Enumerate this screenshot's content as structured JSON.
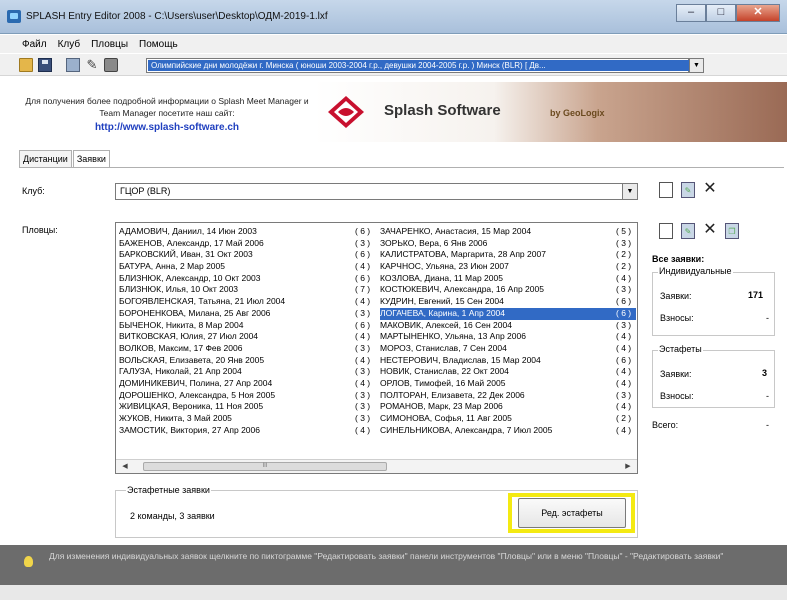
{
  "window": {
    "title": "SPLASH Entry Editor 2008 - C:\\Users\\user\\Desktop\\ОДМ-2019-1.lxf",
    "min_label": "–",
    "max_label": "□",
    "close_label": "✕"
  },
  "menu": [
    "Файл",
    "Клуб",
    "Пловцы",
    "Помощь"
  ],
  "meet": {
    "selected": "Олимпийские дни молодёжи г. Минска ( юноши 2003-2004 г.р., девушки 2004-2005 г.р. ) Минск (BLR) [ Дв..."
  },
  "info": {
    "text": "Для получения более подробной информации о Splash Meet Manager и Team Manager посетите наш сайт:",
    "link": "http://www.splash-software.ch"
  },
  "banner": {
    "brand": "Splash Software",
    "by": "by GeoLogix"
  },
  "tabs": [
    "Дистанции",
    "Заявки"
  ],
  "club": {
    "label": "Клуб:",
    "value": "ГЦОР (BLR)"
  },
  "swimmers_label": "Пловцы:",
  "swimmers_col1": [
    {
      "name": "АДАМОВИЧ, Даниил, 14 Июн 2003",
      "count": "( 6 )"
    },
    {
      "name": "БАЖЕНОВ, Александр, 17 Май 2006",
      "count": "( 3 )"
    },
    {
      "name": "БАРКОВСКИЙ, Иван, 31 Окт 2003",
      "count": "( 6 )"
    },
    {
      "name": "БАТУРА, Анна, 2 Мар 2005",
      "count": "( 4 )"
    },
    {
      "name": "БЛИЗНЮК, Александр, 10 Окт 2003",
      "count": "( 6 )"
    },
    {
      "name": "БЛИЗНЮК, Илья, 10 Окт 2003",
      "count": "( 7 )"
    },
    {
      "name": "БОГОЯВЛЕНСКАЯ, Татьяна, 21 Июл 2004",
      "count": "( 4 )"
    },
    {
      "name": "БОРОНЕНКОВА, Милана, 25 Авг 2006",
      "count": "( 3 )"
    },
    {
      "name": "БЫЧЕНОК, Никита, 8 Мар 2004",
      "count": "( 6 )"
    },
    {
      "name": "ВИТКОВСКАЯ, Юлия, 27 Июл 2004",
      "count": "( 4 )"
    },
    {
      "name": "ВОЛКОВ, Максим, 17 Фев 2006",
      "count": "( 3 )"
    },
    {
      "name": "ВОЛЬСКАЯ, Елизавета, 20 Янв 2005",
      "count": "( 4 )"
    },
    {
      "name": "ГАЛУЗА, Николай, 21 Апр 2004",
      "count": "( 3 )"
    },
    {
      "name": "ДОМИНИКЕВИЧ, Полина, 27 Апр 2004",
      "count": "( 4 )"
    },
    {
      "name": "ДОРОШЕНКО, Александра, 5 Ноя 2005",
      "count": "( 3 )"
    },
    {
      "name": "ЖИВИЦКАЯ, Вероника, 11 Ноя 2005",
      "count": "( 3 )"
    },
    {
      "name": "ЖУКОВ, Никита, 3 Май 2005",
      "count": "( 3 )"
    },
    {
      "name": "ЗАМОСТИК, Виктория, 27 Апр 2006",
      "count": "( 4 )"
    }
  ],
  "swimmers_col2": [
    {
      "name": "ЗАЧАРЕНКО, Анастасия, 15 Мар 2004",
      "count": "( 5 )"
    },
    {
      "name": "ЗОРЬКО, Вера, 6 Янв 2006",
      "count": "( 3 )"
    },
    {
      "name": "КАЛИСТРАТОВА, Маргарита, 28 Апр 2007",
      "count": "( 2 )"
    },
    {
      "name": "КАРЧНОС, Ульяна, 23 Июн 2007",
      "count": "( 2 )"
    },
    {
      "name": "КОЗЛОВА, Диана, 11 Мар 2005",
      "count": "( 4 )"
    },
    {
      "name": "КОСТЮКЕВИЧ, Александра, 16 Апр 2005",
      "count": "( 3 )"
    },
    {
      "name": "КУДРИН, Евгений, 15 Сен 2004",
      "count": "( 6 )"
    },
    {
      "name": "ЛОГАЧЕВА, Карина, 1 Апр 2004",
      "count": "( 6 )"
    },
    {
      "name": "МАКОВИК, Алексей, 16 Сен 2004",
      "count": "( 3 )"
    },
    {
      "name": "МАРТЫНЕНКО, Ульяна, 13 Апр 2006",
      "count": "( 4 )"
    },
    {
      "name": "МОРОЗ, Станислав, 7 Сен 2004",
      "count": "( 4 )"
    },
    {
      "name": "НЕСТЕРОВИЧ, Владислав, 15 Мар 2004",
      "count": "( 6 )"
    },
    {
      "name": "НОВИК, Станислав, 22 Окт 2004",
      "count": "( 4 )"
    },
    {
      "name": "ОРЛОВ, Тимофей, 16 Май 2005",
      "count": "( 4 )"
    },
    {
      "name": "ПОЛТОРАН, Елизавета, 22 Дек 2006",
      "count": "( 3 )"
    },
    {
      "name": "РОМАНОВ, Марк, 23 Мар 2006",
      "count": "( 4 )"
    },
    {
      "name": "СИМОНОВА, Софья, 11 Авг 2005",
      "count": "( 2 )"
    },
    {
      "name": "СИНЕЛЬНИКОВА, Александра, 7 Июл 2005",
      "count": "( 4 )"
    }
  ],
  "selected_swimmer_index": 7,
  "scroll_thumb_label": "III",
  "summary": {
    "title": "Все заявки:",
    "individual": {
      "title": "Индивидуальные",
      "entries_label": "Заявки:",
      "entries_value": "171",
      "fees_label": "Взносы:",
      "fees_value": "-"
    },
    "relay": {
      "title": "Эстафеты",
      "entries_label": "Заявки:",
      "entries_value": "3",
      "fees_label": "Взносы:",
      "fees_value": "-"
    },
    "total_label": "Всего:",
    "total_value": "-"
  },
  "relay_entries": {
    "title": "Эстафетные заявки",
    "text": "2 команды, 3 заявки",
    "button": "Ред. эстафеты"
  },
  "hint": "Для изменения индивидуальных заявок щелкните по пиктограмме \"Редактировать заявки\" панели инструментов \"Пловцы\" или в меню \"Пловцы\" - \"Редактировать заявки\"",
  "colors": {
    "selection": "#316ac5",
    "highlight": "#f4ea12",
    "link": "#1f3fbf"
  }
}
